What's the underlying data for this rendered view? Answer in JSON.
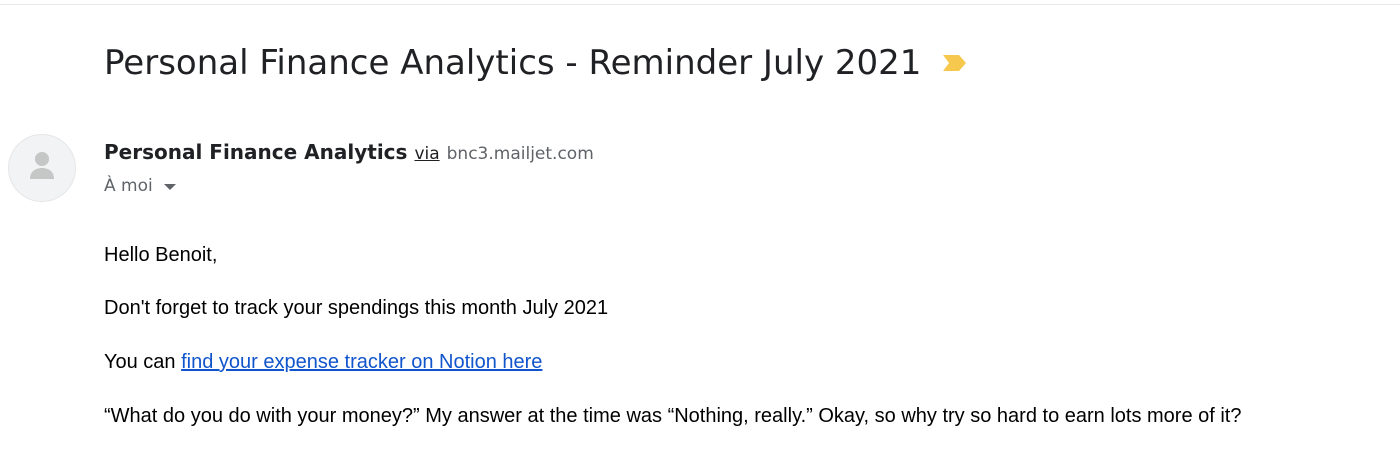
{
  "email": {
    "subject": "Personal Finance Analytics - Reminder July 2021",
    "importance_icon": "importance-marker-icon",
    "importance_color": "#f6c94e",
    "sender": {
      "name": "Personal Finance Analytics",
      "via_label": "via",
      "domain": "bnc3.mailjet.com",
      "avatar_icon": "person-icon"
    },
    "recipient_label": "À moi",
    "body": {
      "greeting": "Hello Benoit,",
      "line1": "Don't forget to track your spendings this month July 2021",
      "line2_prefix": "You can ",
      "line2_link": "find your expense tracker on Notion here",
      "line3": "“What do you do with your money?” My answer at the time was “Nothing, really.” Okay, so why try so hard to earn lots more of it?"
    },
    "link_color": "#1155cc"
  }
}
